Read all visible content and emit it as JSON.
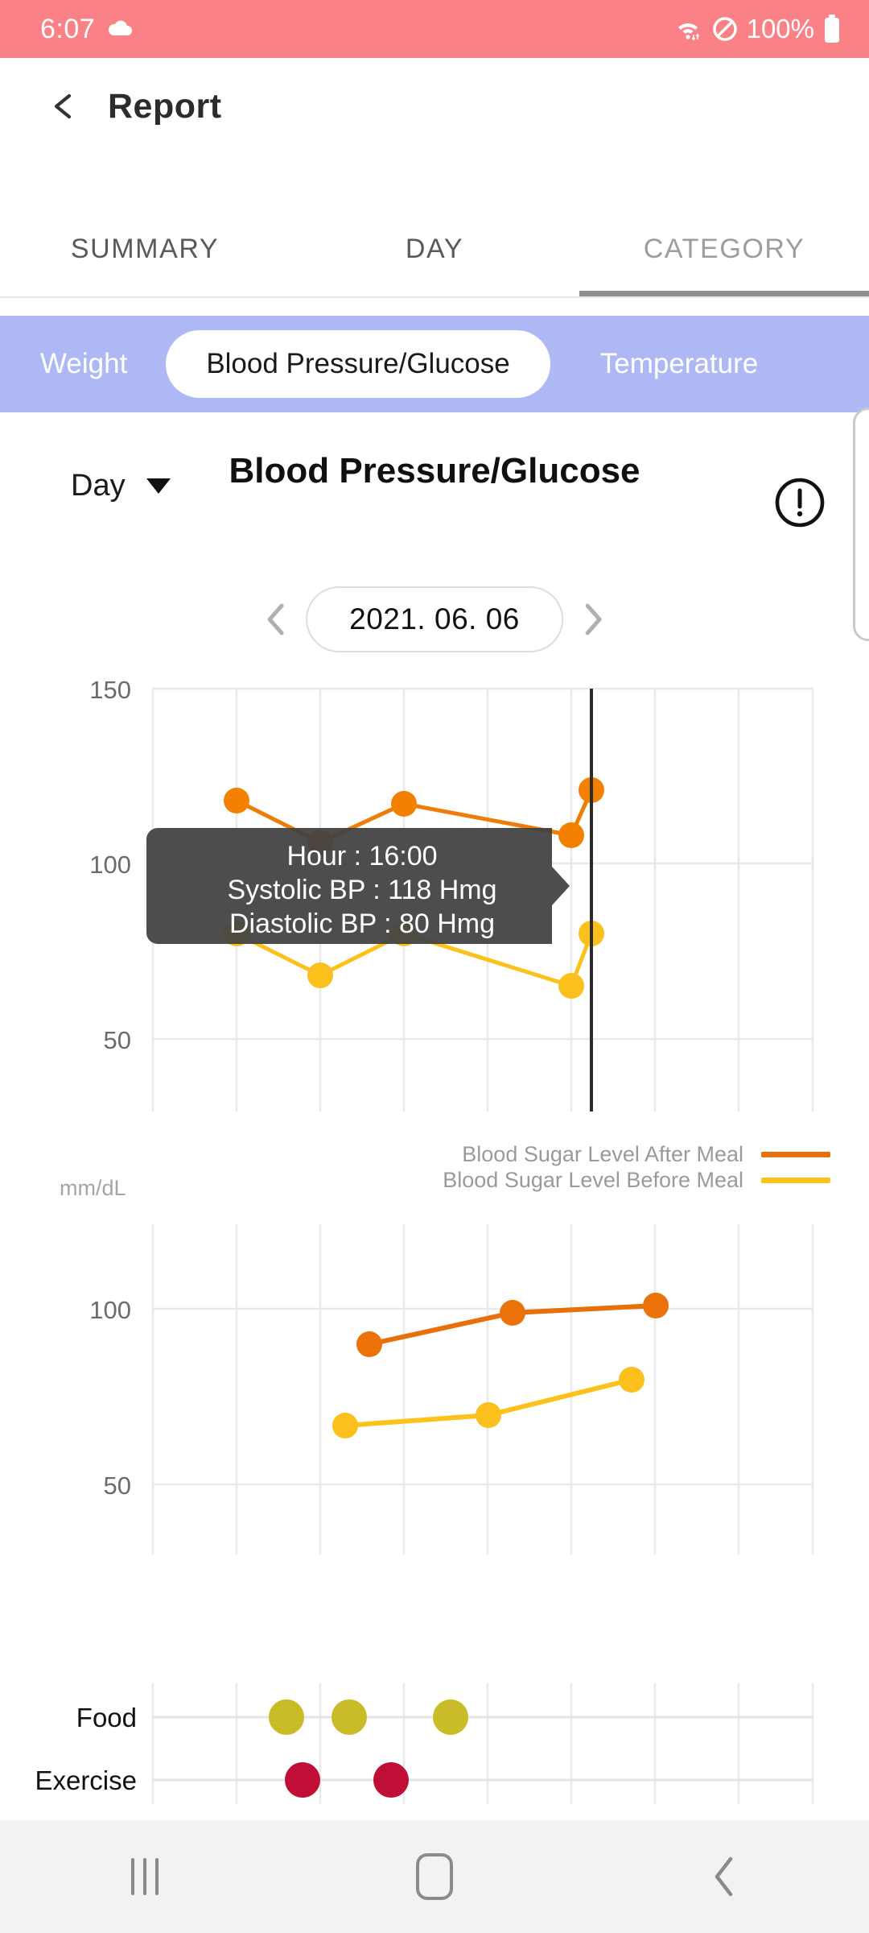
{
  "status_bar": {
    "time": "6:07",
    "battery_percent": "100%",
    "icons": [
      "cloud-icon",
      "wifi-icon",
      "dnd-icon",
      "battery-icon"
    ],
    "background_color": "#fa8287"
  },
  "app_bar": {
    "back_label": "back-arrow",
    "title": "Report"
  },
  "tabs": [
    {
      "label": "SUMMARY",
      "active": false
    },
    {
      "label": "DAY",
      "active": false
    },
    {
      "label": "CATEGORY",
      "active": true
    }
  ],
  "category_chips": {
    "background_color": "#aeb8f5",
    "items": [
      {
        "label": "Weight",
        "active": false
      },
      {
        "label": "Blood Pressure/Glucose",
        "active": true
      },
      {
        "label": "Temperature",
        "active": false
      }
    ]
  },
  "chart_header": {
    "period_selector": "Day",
    "title": "Blood Pressure/Glucose",
    "info_icon": "exclamation-circle-icon"
  },
  "date_nav": {
    "prev": "‹",
    "date": "2021. 06. 06",
    "next": "›"
  },
  "tooltip": {
    "line1": "Hour : 16:00",
    "line2": "Systolic BP : 118 Hmg",
    "line3": "Diastolic BP : 80 Hmg",
    "background_color": "#424242"
  },
  "legend": [
    {
      "label": "Blood Sugar Level After Meal",
      "color": "#e8700a"
    },
    {
      "label": "Blood Sugar Level Before Meal",
      "color": "#fcc21b"
    }
  ],
  "axis_unit": "mm/dL",
  "row_labels": {
    "food": "Food",
    "exercise": "Exercise"
  },
  "nav_bar": {
    "recents": "recents-icon",
    "home": "home-icon",
    "back": "back-icon"
  },
  "chart_data": [
    {
      "type": "line",
      "title": "Blood Pressure",
      "ylabel": "",
      "xlabel": "",
      "ylim": [
        0,
        150
      ],
      "yticks": [
        150,
        100,
        50
      ],
      "grid": true,
      "legend_position": "none",
      "marker_line_x_hour": "16:00",
      "x": [
        6,
        10,
        14,
        19,
        21
      ],
      "series": [
        {
          "name": "Systolic BP",
          "color": "#f28000",
          "values": [
            118,
            106,
            117,
            108,
            121
          ]
        },
        {
          "name": "Diastolic BP",
          "color": "#fcc21b",
          "values": [
            80,
            68,
            80,
            65,
            80
          ]
        }
      ],
      "annotation": "Hour : 16:00 / Systolic BP : 118 Hmg / Diastolic BP : 80 Hmg"
    },
    {
      "type": "line",
      "title": "Blood Sugar",
      "ylabel": "mm/dL",
      "xlabel": "",
      "ylim": [
        0,
        150
      ],
      "yticks": [
        100,
        50
      ],
      "grid": true,
      "legend_position": "top-right",
      "x": [
        9,
        14,
        19
      ],
      "series": [
        {
          "name": "Blood Sugar Level After Meal",
          "color": "#e8700a",
          "values": [
            90,
            99,
            101
          ]
        },
        {
          "name": "Blood Sugar Level Before Meal",
          "color": "#fcc21b",
          "values": [
            67,
            70,
            80
          ]
        }
      ]
    },
    {
      "type": "scatter",
      "title": "Food / Exercise events",
      "rows": [
        "Food",
        "Exercise"
      ],
      "grid": true,
      "series": [
        {
          "name": "Food",
          "color": "#c9bc28",
          "x": [
            9,
            12,
            17
          ]
        },
        {
          "name": "Exercise",
          "color": "#bf0f36",
          "x": [
            10,
            14
          ]
        }
      ]
    }
  ]
}
